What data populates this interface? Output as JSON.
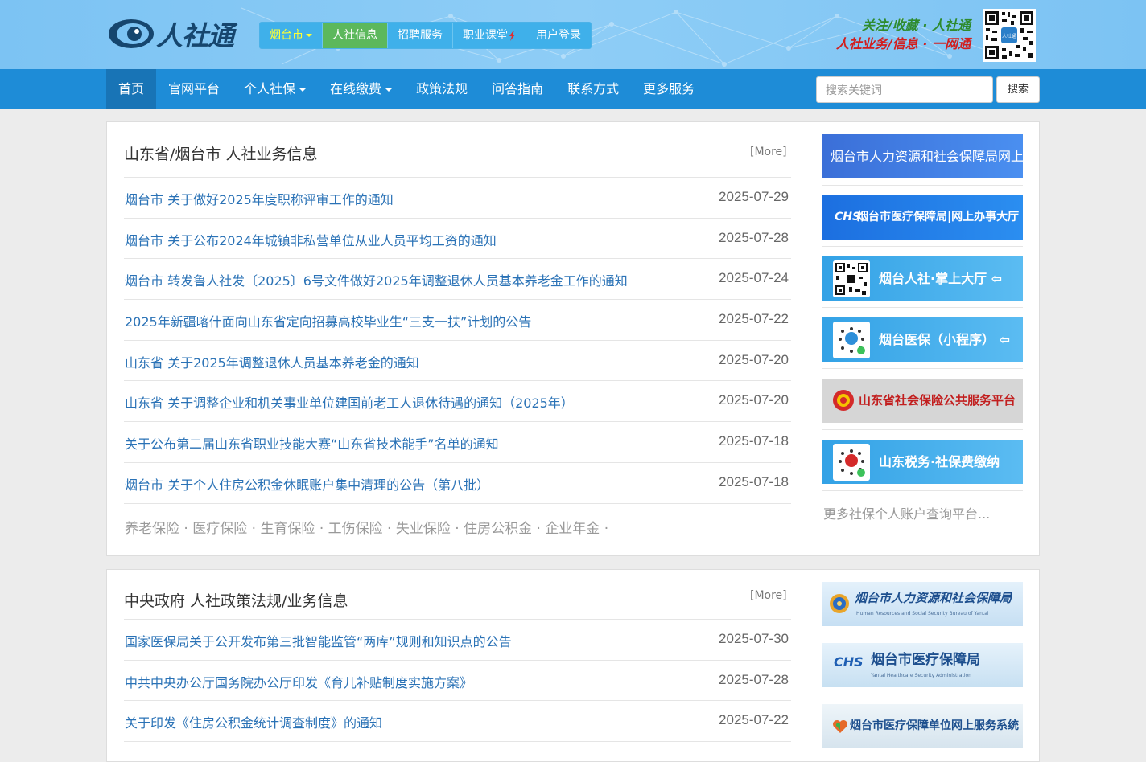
{
  "header": {
    "logo_text": "人社通",
    "top_nav": [
      {
        "label": "烟台市"
      },
      {
        "label": "人社信息"
      },
      {
        "label": "招聘服务"
      },
      {
        "label": "职业课堂"
      },
      {
        "label": "用户登录"
      }
    ],
    "slogan_line1": "关注/收藏 · 人社通",
    "slogan_line2": "人社业务/信息 · 一网通"
  },
  "main_nav": {
    "items": [
      {
        "label": "首页"
      },
      {
        "label": "官网平台"
      },
      {
        "label": "个人社保"
      },
      {
        "label": "在线缴费"
      },
      {
        "label": "政策法规"
      },
      {
        "label": "问答指南"
      },
      {
        "label": "联系方式"
      },
      {
        "label": "更多服务"
      }
    ],
    "search_placeholder": "搜索关键词",
    "search_button": "搜索"
  },
  "section1": {
    "title": "山东省/烟台市 人社业务信息",
    "more": "[More]",
    "items": [
      {
        "title": "烟台市 关于做好2025年度职称评审工作的通知",
        "date": "2025-07-29"
      },
      {
        "title": "烟台市 关于公布2024年城镇非私营单位从业人员平均工资的通知",
        "date": "2025-07-28"
      },
      {
        "title": "烟台市 转发鲁人社发〔2025〕6号文件做好2025年调整退休人员基本养老金工作的通知",
        "date": "2025-07-24"
      },
      {
        "title": "2025年新疆喀什面向山东省定向招募高校毕业生“三支一扶”计划的公告",
        "date": "2025-07-22"
      },
      {
        "title": "山东省 关于2025年调整退休人员基本养老金的通知",
        "date": "2025-07-20"
      },
      {
        "title": "山东省 关于调整企业和机关事业单位建国前老工人退休待遇的通知（2025年）",
        "date": "2025-07-20"
      },
      {
        "title": "关于公布第二届山东省职业技能大赛“山东省技术能手”名单的通知",
        "date": "2025-07-18"
      },
      {
        "title": "烟台市 关于个人住房公积金休眠账户集中清理的公告（第八批）",
        "date": "2025-07-18"
      }
    ],
    "tags": [
      "养老保险",
      "医疗保险",
      "生育保险",
      "工伤保险",
      "失业保险",
      "住房公积金",
      "企业年金"
    ],
    "side_banners": [
      {
        "label": "烟台市人力资源和社会保障局网上服务大厅",
        "color": "#3a7be0"
      },
      {
        "label": "烟台市医疗保障局|网上办事大厅",
        "prefix": "CHS",
        "color": "#1f7de6"
      },
      {
        "label": "烟台人社·掌上大厅 ⇦",
        "color": "#3fa0e8"
      },
      {
        "label": "烟台医保（小程序） ⇦",
        "color": "#3d9fe6"
      },
      {
        "label": "山东省社会保险公共服务平台",
        "color": "#d4d4d4"
      },
      {
        "label": "山东税务·社保费缴纳",
        "color": "#3fa0e8"
      }
    ],
    "side_more": "更多社保个人账户查询平台..."
  },
  "section2": {
    "title": "中央政府 人社政策法规/业务信息",
    "more": "[More]",
    "items": [
      {
        "title": "国家医保局关于公开发布第三批智能监管“两库”规则和知识点的公告",
        "date": "2025-07-30"
      },
      {
        "title": "中共中央办公厅国务院办公厅印发《育儿补贴制度实施方案》",
        "date": "2025-07-28"
      },
      {
        "title": "关于印发《住房公积金统计调查制度》的通知",
        "date": "2025-07-22"
      }
    ],
    "side_banners": [
      {
        "label": "烟台市人力资源和社会保障局",
        "sub": "Human Resources and Social Security Bureau of Yantai"
      },
      {
        "label": "烟台市医疗保障局",
        "prefix": "CHS",
        "sub": "Yantai Healthcare Security Administration"
      },
      {
        "label": "烟台市医疗保障单位网上服务系统"
      }
    ]
  }
}
